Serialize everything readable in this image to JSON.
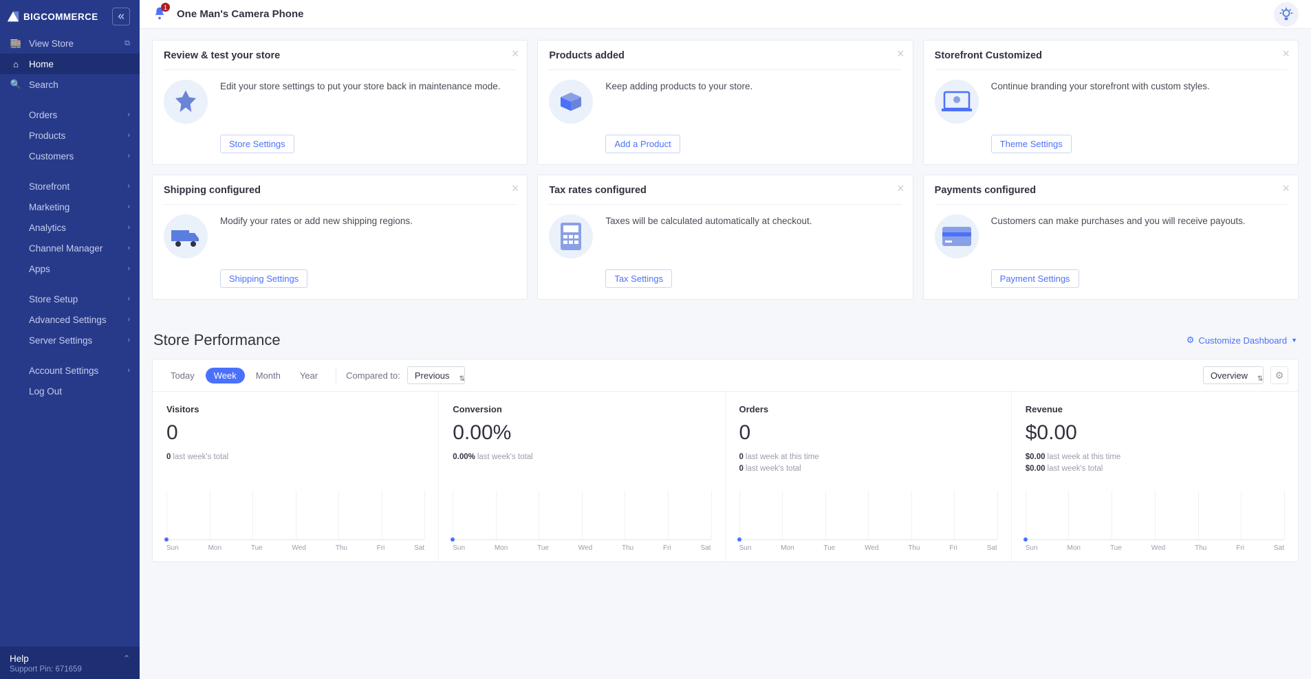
{
  "brand": "BIGCOMMERCE",
  "notifications": "1",
  "store_name": "One Man's Camera Phone",
  "sidebar": {
    "view_store": "View Store",
    "home": "Home",
    "search": "Search",
    "groups": [
      [
        "Orders",
        "Products",
        "Customers"
      ],
      [
        "Storefront",
        "Marketing",
        "Analytics",
        "Channel Manager",
        "Apps"
      ],
      [
        "Store Setup",
        "Advanced Settings",
        "Server Settings"
      ],
      [
        "Account Settings",
        "Log Out"
      ]
    ],
    "help": "Help",
    "pin_label": "Support Pin:",
    "pin_value": "671659"
  },
  "cards": [
    {
      "title": "Review & test your store",
      "desc": "Edit your store settings to put your store back in maintenance mode.",
      "button": "Store Settings"
    },
    {
      "title": "Products added",
      "desc": "Keep adding products to your store.",
      "button": "Add a Product"
    },
    {
      "title": "Storefront Customized",
      "desc": "Continue branding your storefront with custom styles.",
      "button": "Theme Settings"
    },
    {
      "title": "Shipping configured",
      "desc": "Modify your rates or add new shipping regions.",
      "button": "Shipping Settings"
    },
    {
      "title": "Tax rates configured",
      "desc": "Taxes will be calculated automatically at checkout.",
      "button": "Tax Settings"
    },
    {
      "title": "Payments configured",
      "desc": "Customers can make purchases and you will receive payouts.",
      "button": "Payment Settings"
    }
  ],
  "performance": {
    "heading": "Store Performance",
    "customize": "Customize Dashboard",
    "ranges": [
      "Today",
      "Week",
      "Month",
      "Year"
    ],
    "active_range": "Week",
    "compared_label": "Compared to:",
    "compared_value": "Previous",
    "overview": "Overview",
    "metrics": [
      {
        "title": "Visitors",
        "value": "0",
        "subs": [
          [
            "0",
            "last week's total"
          ]
        ]
      },
      {
        "title": "Conversion",
        "value": "0.00%",
        "subs": [
          [
            "0.00%",
            "last week's total"
          ]
        ]
      },
      {
        "title": "Orders",
        "value": "0",
        "subs": [
          [
            "0",
            "last week at this time"
          ],
          [
            "0",
            "last week's total"
          ]
        ]
      },
      {
        "title": "Revenue",
        "value": "$0.00",
        "subs": [
          [
            "$0.00",
            "last week at this time"
          ],
          [
            "$0.00",
            "last week's total"
          ]
        ]
      }
    ],
    "days": [
      "Sun",
      "Mon",
      "Tue",
      "Wed",
      "Thu",
      "Fri",
      "Sat"
    ]
  },
  "chart_data": [
    {
      "type": "line",
      "categories": [
        "Sun",
        "Mon",
        "Tue",
        "Wed",
        "Thu",
        "Fri",
        "Sat"
      ],
      "values": [
        0,
        0,
        0,
        0,
        0,
        0,
        0
      ],
      "title": "Visitors",
      "ylim": [
        0,
        1
      ]
    },
    {
      "type": "line",
      "categories": [
        "Sun",
        "Mon",
        "Tue",
        "Wed",
        "Thu",
        "Fri",
        "Sat"
      ],
      "values": [
        0,
        0,
        0,
        0,
        0,
        0,
        0
      ],
      "title": "Conversion",
      "ylim": [
        0,
        1
      ]
    },
    {
      "type": "line",
      "categories": [
        "Sun",
        "Mon",
        "Tue",
        "Wed",
        "Thu",
        "Fri",
        "Sat"
      ],
      "values": [
        0,
        0,
        0,
        0,
        0,
        0,
        0
      ],
      "title": "Orders",
      "ylim": [
        0,
        1
      ]
    },
    {
      "type": "line",
      "categories": [
        "Sun",
        "Mon",
        "Tue",
        "Wed",
        "Thu",
        "Fri",
        "Sat"
      ],
      "values": [
        0,
        0,
        0,
        0,
        0,
        0,
        0
      ],
      "title": "Revenue",
      "ylim": [
        0,
        1
      ]
    }
  ]
}
